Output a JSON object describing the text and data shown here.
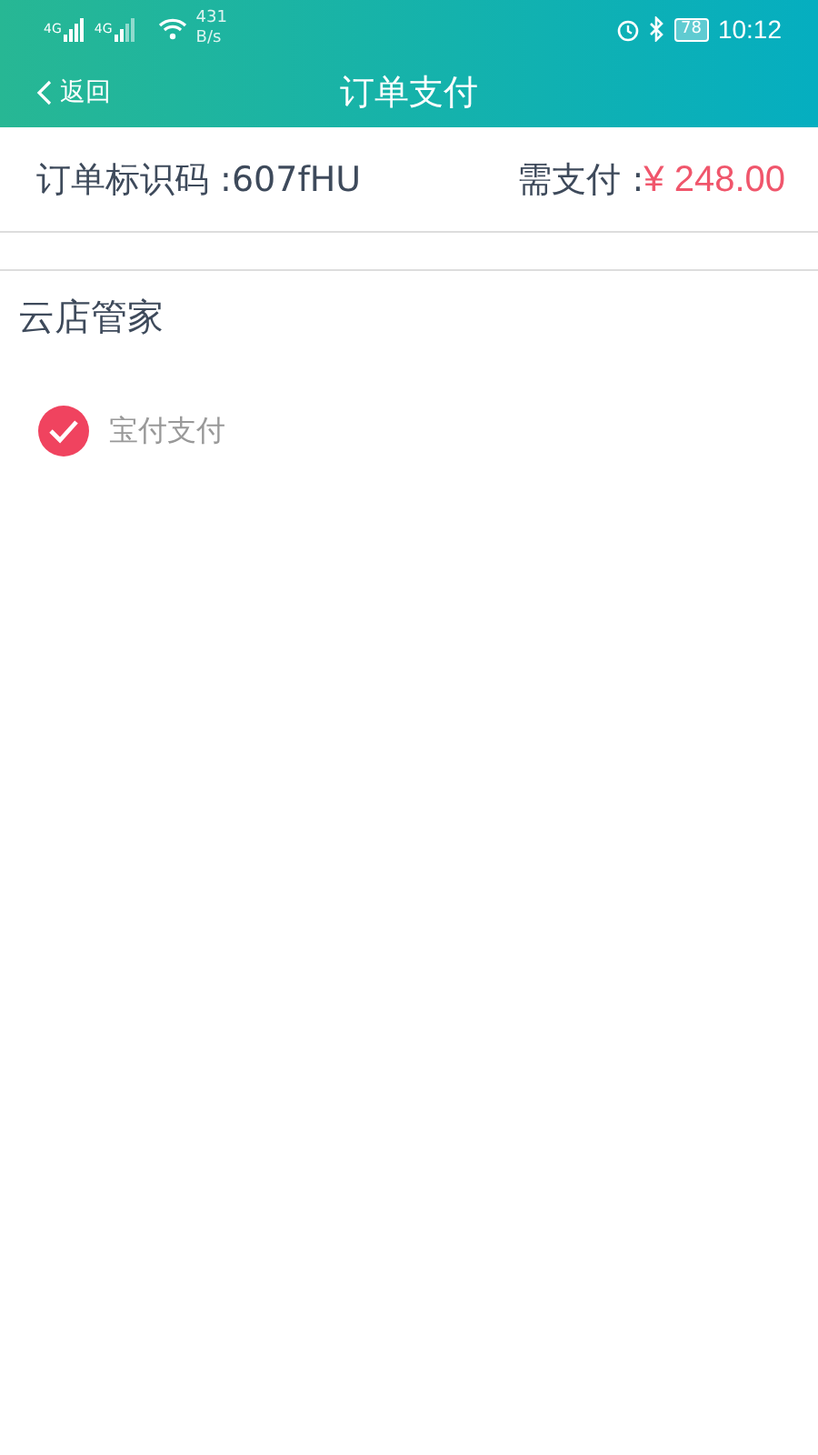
{
  "status_bar": {
    "network_1": "4G",
    "network_2": "4G",
    "speed_value": "431",
    "speed_unit": "B/s",
    "battery": "78",
    "time": "10:12"
  },
  "nav": {
    "back": "返回",
    "title": "订单支付"
  },
  "order": {
    "id_label": "订单标识码 :",
    "id_value": "607fHU",
    "amount_label": "需支付 :",
    "amount": "¥ 248.00"
  },
  "section": {
    "title": "云店管家",
    "methods": [
      {
        "label": "宝付支付",
        "selected": true
      }
    ]
  }
}
